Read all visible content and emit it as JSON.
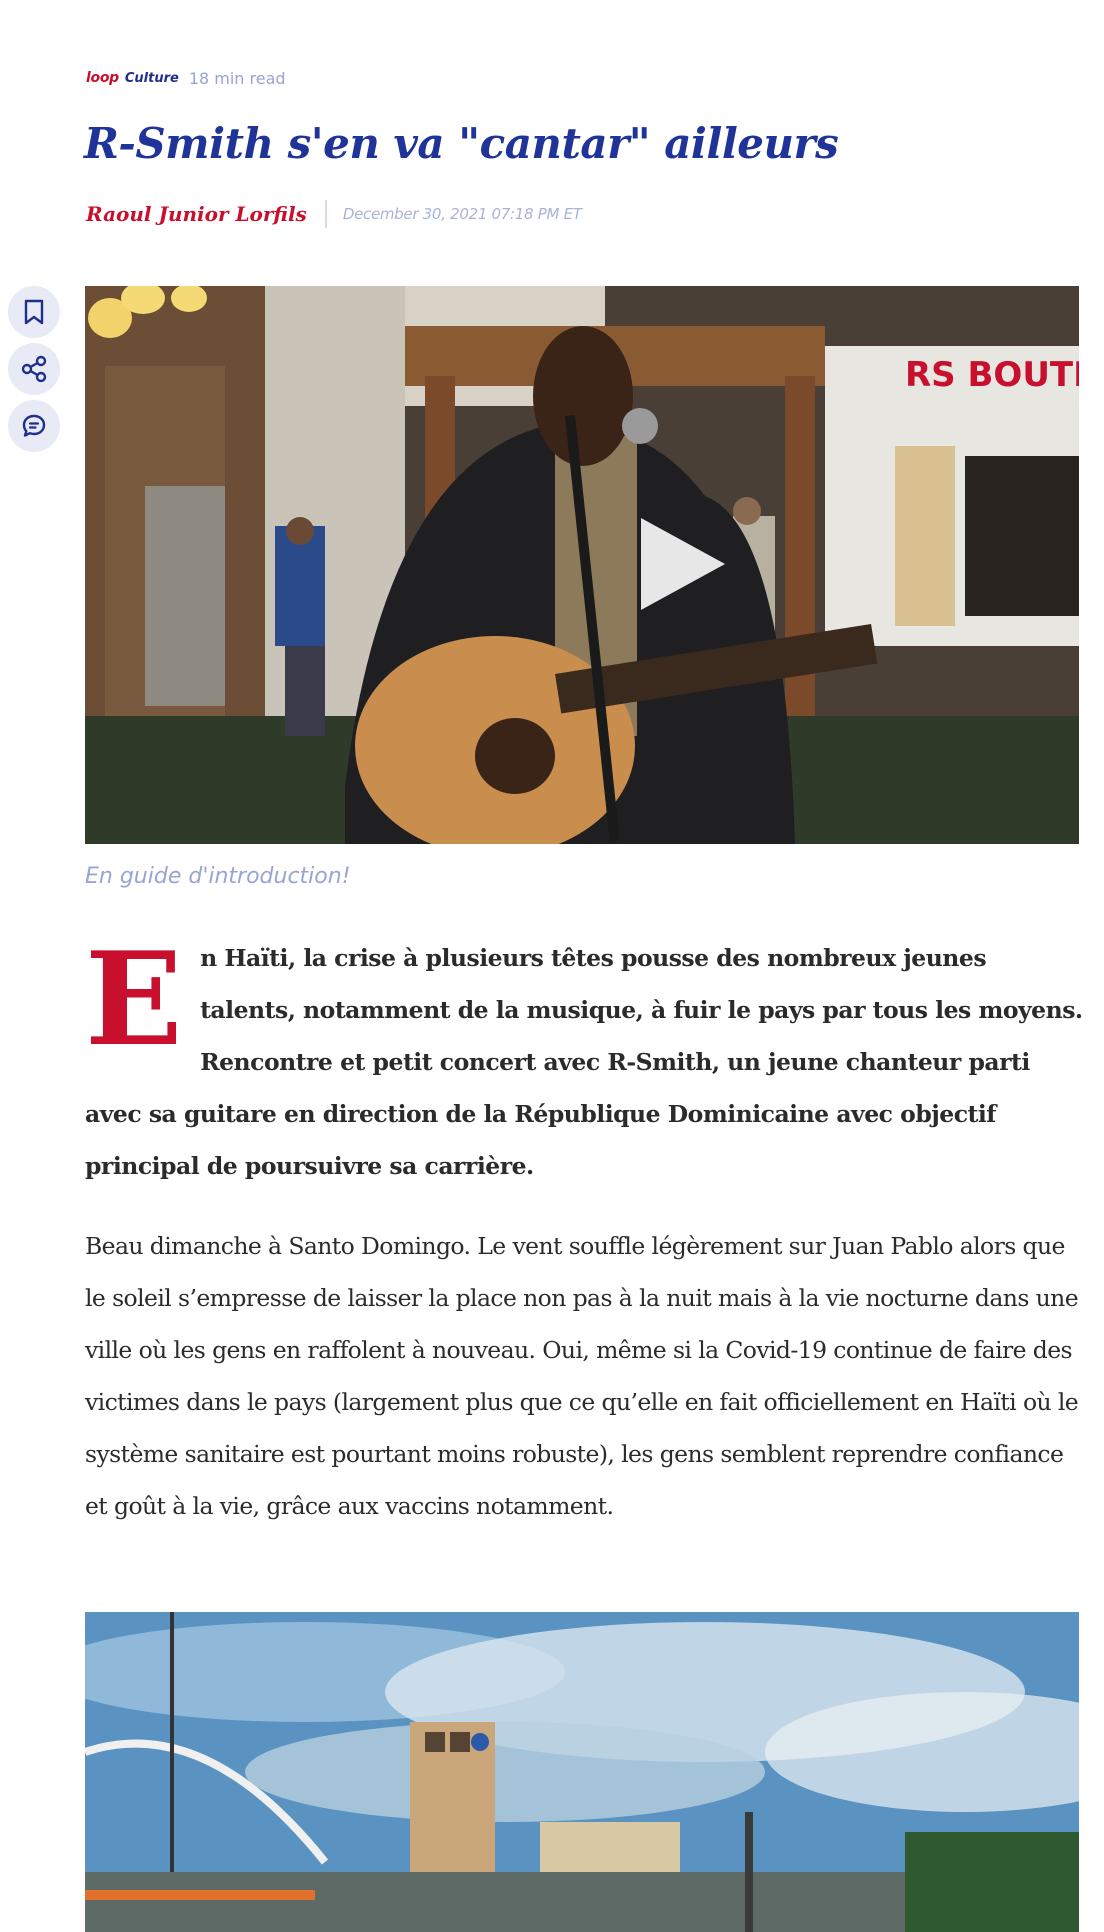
{
  "meta": {
    "logo_text": "loop",
    "section": "Culture",
    "read_time": "18 min read"
  },
  "article": {
    "title": "R-Smith s'en va \"cantar\" ailleurs",
    "author": "Raoul Junior Lorfils",
    "date": "December 30, 2021 07:18 PM ET",
    "hero_caption": "En guide d'introduction!",
    "lead_dropcap": "E",
    "lead_text": "n Haïti, la crise à plusieurs têtes pousse des nombreux jeunes talents, notamment de la musique, à fuir le pays par tous les moyens. Rencontre et petit concert avec R-Smith, un jeune chanteur parti avec sa guitare en direction de la République Dominicaine avec objectif principal de poursuivre sa carrière.",
    "paragraph_1": "Beau dimanche à Santo Domingo. Le vent souffle légèrement sur Juan Pablo alors que le soleil s’empresse de laisser la place non pas à la nuit mais à la vie nocturne dans une ville où les gens en raffolent à nouveau. Oui, même si la Covid-19 continue de faire des victimes dans le pays (largement plus que ce qu’elle en fait officiellement en Haïti où le système sanitaire est pourtant moins robuste), les gens semblent reprendre confiance et goût à la vie, grâce aux vaccins notamment.",
    "store_sign": "RS BOUTIQUE"
  },
  "side_actions": [
    {
      "icon": "bookmark-icon"
    },
    {
      "icon": "share-icon"
    },
    {
      "icon": "comment-icon"
    }
  ],
  "colors": {
    "brand_red": "#c8102e",
    "brand_blue": "#1f3399",
    "muted_blue": "#9aa4d4"
  }
}
